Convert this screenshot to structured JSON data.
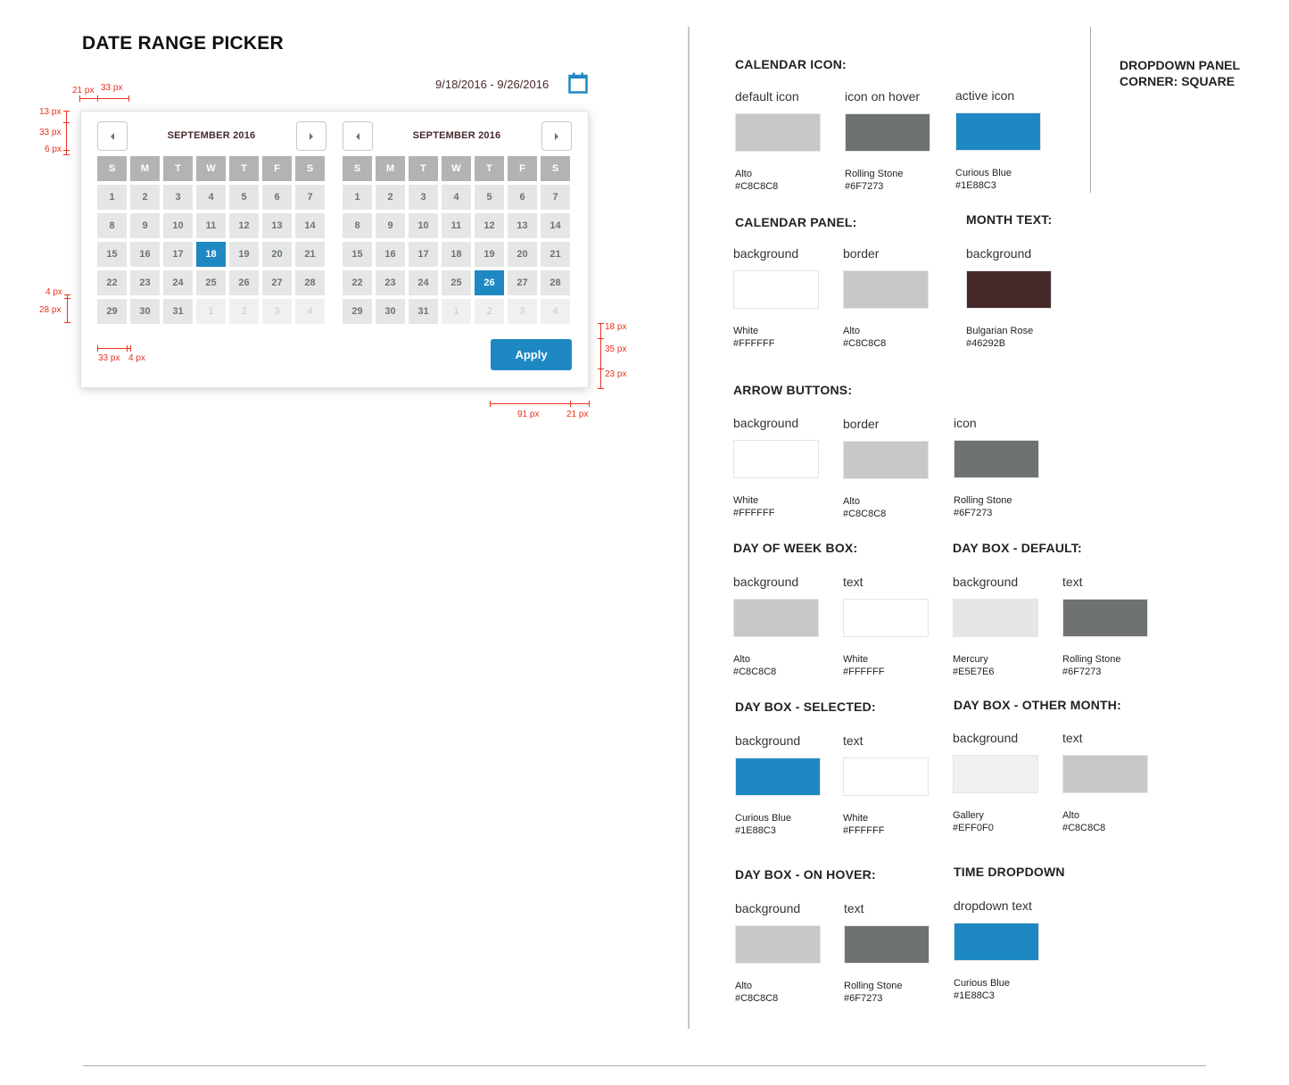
{
  "page": {
    "title": "DATE RANGE PICKER"
  },
  "date_input": {
    "value": "9/18/2016 - 9/26/2016",
    "icon": "calendar-icon",
    "icon_color": "#1E88C3"
  },
  "picker": {
    "weekdays": [
      "S",
      "M",
      "T",
      "W",
      "T",
      "F",
      "S"
    ],
    "months": [
      {
        "label": "SEPTEMBER 2016",
        "prev_icon": "arrow-left-icon",
        "next_icon": "arrow-right-icon",
        "days": [
          "1",
          "2",
          "3",
          "4",
          "5",
          "6",
          "7",
          "8",
          "9",
          "10",
          "11",
          "12",
          "13",
          "14",
          "15",
          "16",
          "17",
          "18",
          "19",
          "20",
          "21",
          "22",
          "23",
          "24",
          "25",
          "26",
          "27",
          "28",
          "29",
          "30",
          "31"
        ],
        "trailing_days": [
          "1",
          "2",
          "3",
          "4"
        ],
        "selected": "18"
      },
      {
        "label": "SEPTEMBER 2016",
        "prev_icon": "arrow-left-icon",
        "next_icon": "arrow-right-icon",
        "days": [
          "1",
          "2",
          "3",
          "4",
          "5",
          "6",
          "7",
          "8",
          "9",
          "10",
          "11",
          "12",
          "13",
          "14",
          "15",
          "16",
          "17",
          "18",
          "19",
          "20",
          "21",
          "22",
          "23",
          "24",
          "25",
          "26",
          "27",
          "28",
          "29",
          "30",
          "31"
        ],
        "trailing_days": [
          "1",
          "2",
          "3",
          "4"
        ],
        "selected": "26"
      }
    ],
    "apply_label": "Apply"
  },
  "annotations": {
    "top_21": "21 px",
    "top_33": "33 px",
    "left_13": "13 px",
    "left_33": "33 px",
    "left_6": "6 px",
    "left_4": "4 px",
    "left_28": "28 px",
    "bottom_33": "33 px",
    "bottom_4": "4 px",
    "right_18": "18 px",
    "right_35": "35 px",
    "right_23": "23 px",
    "btn_91": "91 px",
    "btn_21": "21 px"
  },
  "note": {
    "line1": "DROPDOWN PANEL",
    "line2": "CORNER:  SQUARE"
  },
  "spec": {
    "calendar_icon": {
      "title": "CALENDAR ICON:",
      "swatches": [
        {
          "label": "default icon",
          "name": "Alto",
          "hex": "#C8C8C8"
        },
        {
          "label": "icon on hover",
          "name": "Rolling Stone",
          "hex": "#6F7273"
        },
        {
          "label": "active icon",
          "name": "Curious Blue",
          "hex": "#1E88C3"
        }
      ]
    },
    "calendar_panel": {
      "title": "CALENDAR PANEL:",
      "swatches": [
        {
          "label": "background",
          "name": "White",
          "hex": "#FFFFFF"
        },
        {
          "label": "border",
          "name": "Alto",
          "hex": "#C8C8C8"
        }
      ]
    },
    "month_text": {
      "title": "MONTH TEXT:",
      "swatches": [
        {
          "label": "background",
          "name": "Bulgarian Rose",
          "hex": "#46292B"
        }
      ]
    },
    "arrow_buttons": {
      "title": "ARROW BUTTONS:",
      "swatches": [
        {
          "label": "background",
          "name": "White",
          "hex": "#FFFFFF"
        },
        {
          "label": "border",
          "name": "Alto",
          "hex": "#C8C8C8"
        },
        {
          "label": "icon",
          "name": "Rolling Stone",
          "hex": "#6F7273"
        }
      ]
    },
    "day_of_week_box": {
      "title": "DAY OF WEEK BOX:",
      "swatches": [
        {
          "label": "background",
          "name": "Alto",
          "hex": "#C8C8C8"
        },
        {
          "label": "text",
          "name": "White",
          "hex": "#FFFFFF"
        }
      ]
    },
    "day_box_default": {
      "title": "DAY BOX - DEFAULT:",
      "swatches": [
        {
          "label": "background",
          "name": "Mercury",
          "hex": "#E5E7E6"
        },
        {
          "label": "text",
          "name": "Rolling Stone",
          "hex": "#6F7273"
        }
      ]
    },
    "day_box_selected": {
      "title": "DAY BOX - SELECTED:",
      "swatches": [
        {
          "label": "background",
          "name": "Curious Blue",
          "hex": "#1E88C3"
        },
        {
          "label": "text",
          "name": "White",
          "hex": "#FFFFFF"
        }
      ]
    },
    "day_box_other_month": {
      "title": "DAY BOX - OTHER MONTH:",
      "swatches": [
        {
          "label": "background",
          "name": "Gallery",
          "hex": "#EFF0F0"
        },
        {
          "label": "text",
          "name": "Alto",
          "hex": "#C8C8C8"
        }
      ]
    },
    "day_box_hover": {
      "title": "DAY BOX - ON HOVER:",
      "swatches": [
        {
          "label": "background",
          "name": "Alto",
          "hex": "#C8C8C8"
        },
        {
          "label": "text",
          "name": "Rolling Stone",
          "hex": "#6F7273"
        }
      ]
    },
    "time_dropdown": {
      "title": "TIME DROPDOWN",
      "swatches": [
        {
          "label": "dropdown text",
          "name": "Curious Blue",
          "hex": "#1E88C3"
        }
      ]
    }
  }
}
